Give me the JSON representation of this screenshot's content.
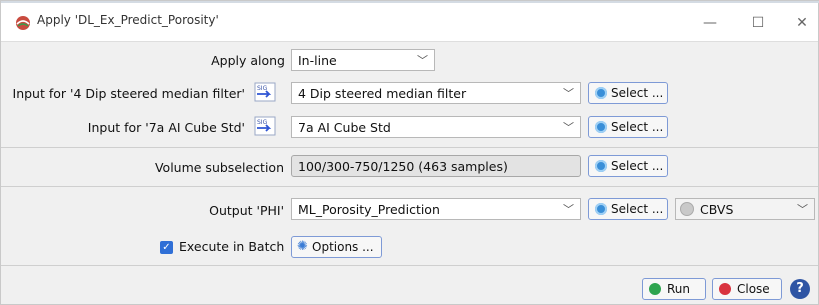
{
  "window": {
    "title": "Apply 'DL_Ex_Predict_Porosity'",
    "minimize": "—",
    "maximize": "☐",
    "close": "✕"
  },
  "apply_along": {
    "label": "Apply along",
    "value": "In-line"
  },
  "input1": {
    "label": "Input for '4 Dip steered median filter'",
    "value": "4 Dip steered median filter",
    "select_label": "Select ..."
  },
  "input2": {
    "label": "Input for '7a AI Cube Std'",
    "value": "7a AI Cube Std",
    "select_label": "Select ..."
  },
  "volume": {
    "label": "Volume subselection",
    "value": "100/300-750/1250 (463 samples)",
    "select_label": "Select ..."
  },
  "output": {
    "label": "Output 'PHI'",
    "value": "ML_Porosity_Prediction",
    "select_label": "Select ...",
    "format_value": "CBVS"
  },
  "batch": {
    "label": "Execute in Batch",
    "checked": true,
    "options_label": "Options ..."
  },
  "footer": {
    "run_label": "Run",
    "close_label": "Close",
    "help_label": "?"
  },
  "steer_icon_text": "SIG",
  "colors": {
    "accent": "#2f6fd6",
    "run_icon": "#2ea44f",
    "close_icon": "#d9333f",
    "help": "#2f55a4"
  }
}
